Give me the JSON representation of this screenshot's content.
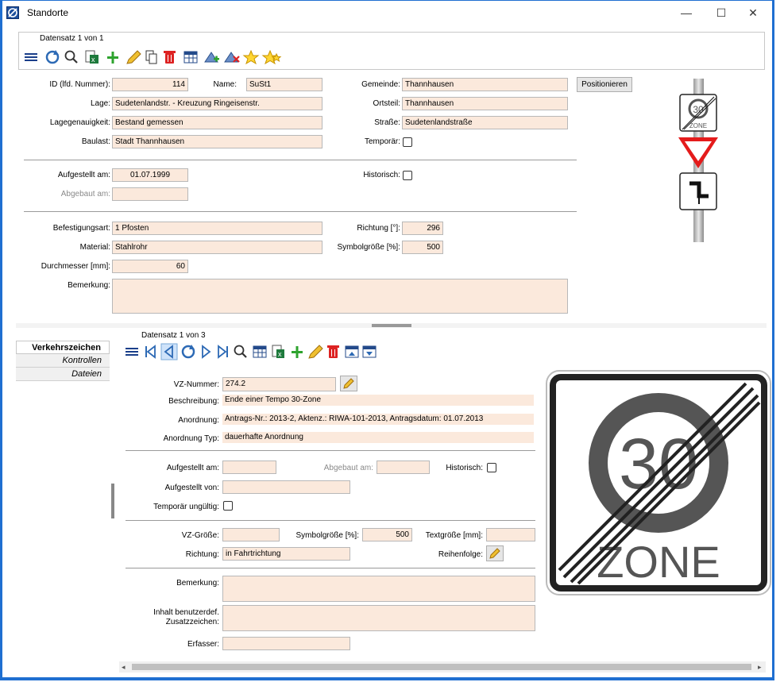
{
  "window": {
    "title": "Standorte",
    "minimize": "—",
    "maximize": "☐",
    "close": "✕"
  },
  "top": {
    "record_label": "Datensatz 1 von 1",
    "fields": {
      "id_label": "ID (lfd. Nummer):",
      "id_value": "114",
      "name_label": "Name:",
      "name_value": "SuSt1",
      "gemeinde_label": "Gemeinde:",
      "gemeinde_value": "Thannhausen",
      "positionieren_label": "Positionieren",
      "lage_label": "Lage:",
      "lage_value": "Sudetenlandstr. - Kreuzung  Ringeisenstr.",
      "ortsteil_label": "Ortsteil:",
      "ortsteil_value": "Thannhausen",
      "lagegenauigkeit_label": "Lagegenauigkeit:",
      "lagegenauigkeit_value": "Bestand gemessen",
      "strasse_label": "Straße:",
      "strasse_value": "Sudetenlandstraße",
      "baulast_label": "Baulast:",
      "baulast_value": "Stadt Thannhausen",
      "temporaer_label": "Temporär:",
      "aufgestellt_label": "Aufgestellt am:",
      "aufgestellt_value": "01.07.1999",
      "historisch_label": "Historisch:",
      "abgebaut_label": "Abgebaut am:",
      "abgebaut_value": "",
      "befestigung_label": "Befestigungsart:",
      "befestigung_value": "1 Pfosten",
      "richtung_label": "Richtung [°]:",
      "richtung_value": "296",
      "material_label": "Material:",
      "material_value": "Stahlrohr",
      "symbolgroesse_label": "Symbolgröße [%]:",
      "symbolgroesse_value": "500",
      "durchmesser_label": "Durchmesser [mm]:",
      "durchmesser_value": "60",
      "bemerkung_label": "Bemerkung:",
      "bemerkung_value": ""
    },
    "preview_sign_text": "ZONE",
    "preview_sign_number": "30"
  },
  "bottom": {
    "tabs": [
      "Verkehrszeichen",
      "Kontrollen",
      "Dateien"
    ],
    "record_label": "Datensatz 1 von 3",
    "fields": {
      "vz_nummer_label": "VZ-Nummer:",
      "vz_nummer_value": "274.2",
      "beschreibung_label": "Beschreibung:",
      "beschreibung_value": "Ende einer Tempo 30-Zone",
      "anordnung_label": "Anordnung:",
      "anordnung_value": "Antrags-Nr.: 2013-2, Aktenz.: RIWA-101-2013, Antragsdatum: 01.07.2013",
      "anordnung_typ_label": "Anordnung Typ:",
      "anordnung_typ_value": "dauerhafte Anordnung",
      "aufgestellt_label": "Aufgestellt am:",
      "abgebaut_label": "Abgebaut am:",
      "historisch_label": "Historisch:",
      "aufgestellt_von_label": "Aufgestellt von:",
      "temporaer_label": "Temporär ungültig:",
      "vz_groesse_label": "VZ-Größe:",
      "symbolgroesse_label": "Symbolgröße [%]:",
      "symbolgroesse_value": "500",
      "textgroesse_label": "Textgröße [mm]:",
      "richtung_label": "Richtung:",
      "richtung_value": "in Fahrtrichtung",
      "reihenfolge_label": "Reihenfolge:",
      "bemerkung_label": "Bemerkung:",
      "inhalt_label_1": "Inhalt benutzerdef.",
      "inhalt_label_2": "Zusatzzeichen:",
      "erfasser_label": "Erfasser:"
    },
    "sign_number": "30",
    "sign_text": "ZONE"
  }
}
